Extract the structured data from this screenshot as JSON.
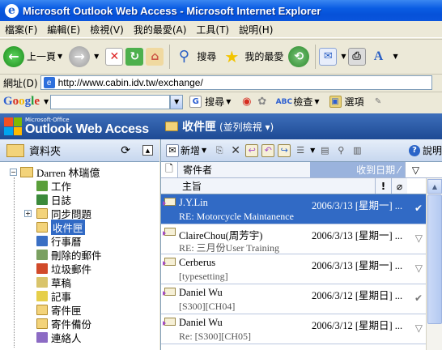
{
  "window": {
    "title": "Microsoft Outlook Web Access - Microsoft Internet Explorer"
  },
  "menu": [
    "檔案(F)",
    "編輯(E)",
    "檢視(V)",
    "我的最愛(A)",
    "工具(T)",
    "說明(H)"
  ],
  "toolbar": {
    "back_label": "上一頁",
    "search_label": "搜尋",
    "favorites_label": "我的最愛"
  },
  "address": {
    "label": "網址(D)",
    "url": "http://www.cabin.idv.tw/exchange/"
  },
  "google": {
    "logo": "Google",
    "search_label": "搜尋",
    "check_label": "檢查",
    "options_label": "選項"
  },
  "owa": {
    "ms_label": "Microsoft·Office",
    "brand": "Outlook Web Access",
    "current_folder": "收件匣",
    "view_label": "(並列檢視 ▾)"
  },
  "folders": {
    "header": "資料夾",
    "root": "Darren 林瑞億",
    "items": [
      {
        "label": "工作",
        "color": "#5a9f3a"
      },
      {
        "label": "日誌",
        "color": "#3b8a3b"
      },
      {
        "label": "同步問題",
        "color": "#f3d37a"
      },
      {
        "label": "收件匣",
        "color": "#f3d37a"
      },
      {
        "label": "行事曆",
        "color": "#3a6fc4"
      },
      {
        "label": "刪除的郵件",
        "color": "#7aa061"
      },
      {
        "label": "垃圾郵件",
        "color": "#d14a2a"
      },
      {
        "label": "草稿",
        "color": "#d9c46b"
      },
      {
        "label": "記事",
        "color": "#e6cf4a"
      },
      {
        "label": "寄件匣",
        "color": "#f3d37a"
      },
      {
        "label": "寄件備份",
        "color": "#f3d37a"
      },
      {
        "label": "連絡人",
        "color": "#8c6bc4"
      }
    ]
  },
  "list": {
    "new_label": "新增",
    "help_label": "說明",
    "col_sender": "寄件者",
    "col_date": "收到日期",
    "col_subject": "主旨",
    "col_importance": "!",
    "messages": [
      {
        "from": "J.Y.Lin",
        "date": "2006/3/13 [星期一] ...",
        "subject": "RE: Motorcycle Maintanence",
        "flag": "✔"
      },
      {
        "from": "ClaireChou(周芳宇)",
        "date": "2006/3/13 [星期一] ...",
        "subject": "RE: 三月份User Training",
        "flag": "▽"
      },
      {
        "from": "Cerberus",
        "date": "2006/3/13 [星期一] ...",
        "subject": "[typesetting]",
        "flag": "▽"
      },
      {
        "from": "Daniel Wu",
        "date": "2006/3/12 [星期日] ...",
        "subject": "[S300][CH04]",
        "flag": "✔"
      },
      {
        "from": "Daniel Wu",
        "date": "2006/3/12 [星期日] ...",
        "subject": "Re: [S300][CH05]",
        "flag": "▽"
      }
    ]
  }
}
